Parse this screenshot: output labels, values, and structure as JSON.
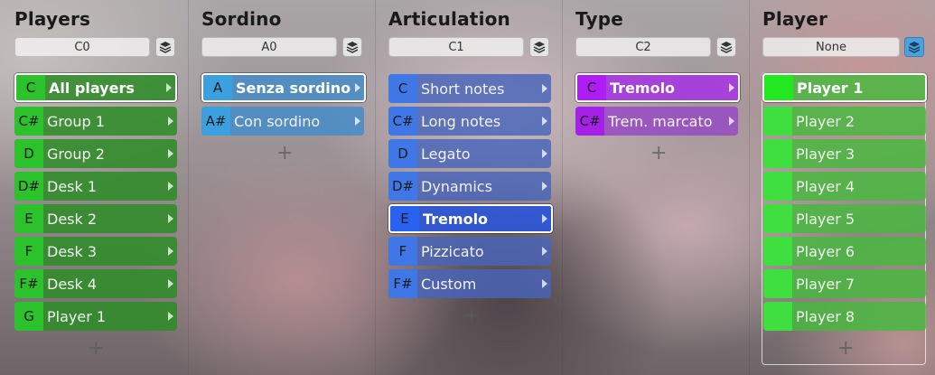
{
  "columns": [
    {
      "title": "Players",
      "selector": "C0",
      "items": [
        {
          "key": "C",
          "label": "All players"
        },
        {
          "key": "C#",
          "label": "Group 1"
        },
        {
          "key": "D",
          "label": "Group 2"
        },
        {
          "key": "D#",
          "label": "Desk 1"
        },
        {
          "key": "E",
          "label": "Desk 2"
        },
        {
          "key": "F",
          "label": "Desk 3"
        },
        {
          "key": "F#",
          "label": "Desk 4"
        },
        {
          "key": "G",
          "label": "Player 1"
        }
      ],
      "add": "+"
    },
    {
      "title": "Sordino",
      "selector": "A0",
      "items": [
        {
          "key": "A",
          "label": "Senza sordino"
        },
        {
          "key": "A#",
          "label": "Con sordino"
        }
      ],
      "add": "+"
    },
    {
      "title": "Articulation",
      "selector": "C1",
      "items": [
        {
          "key": "C",
          "label": "Short notes"
        },
        {
          "key": "C#",
          "label": "Long notes"
        },
        {
          "key": "D",
          "label": "Legato"
        },
        {
          "key": "D#",
          "label": "Dynamics"
        },
        {
          "key": "E",
          "label": "Tremolo"
        },
        {
          "key": "F",
          "label": "Pizzicato"
        },
        {
          "key": "F#",
          "label": "Custom"
        }
      ],
      "add": "+"
    },
    {
      "title": "Type",
      "selector": "C2",
      "items": [
        {
          "key": "C",
          "label": "Tremolo"
        },
        {
          "key": "C#",
          "label": "Trem. marcato"
        }
      ],
      "add": "+"
    },
    {
      "title": "Player",
      "selector": "None",
      "items": [
        {
          "key": "",
          "label": "Player 1"
        },
        {
          "key": "",
          "label": "Player 2"
        },
        {
          "key": "",
          "label": "Player 3"
        },
        {
          "key": "",
          "label": "Player 4"
        },
        {
          "key": "",
          "label": "Player 5"
        },
        {
          "key": "",
          "label": "Player 6"
        },
        {
          "key": "",
          "label": "Player 7"
        },
        {
          "key": "",
          "label": "Player 8"
        }
      ],
      "add": "+"
    }
  ],
  "icons": {
    "layer": "layers-icon",
    "expand": "triangle-right-icon",
    "add": "plus-icon"
  },
  "colors": {
    "green": "#2bc22b",
    "blue": "#3aa0e0",
    "indigo": "#3f78e6",
    "purple": "#a521e8",
    "player_green": "#40df40",
    "layer_active": "#4aa3e0"
  }
}
